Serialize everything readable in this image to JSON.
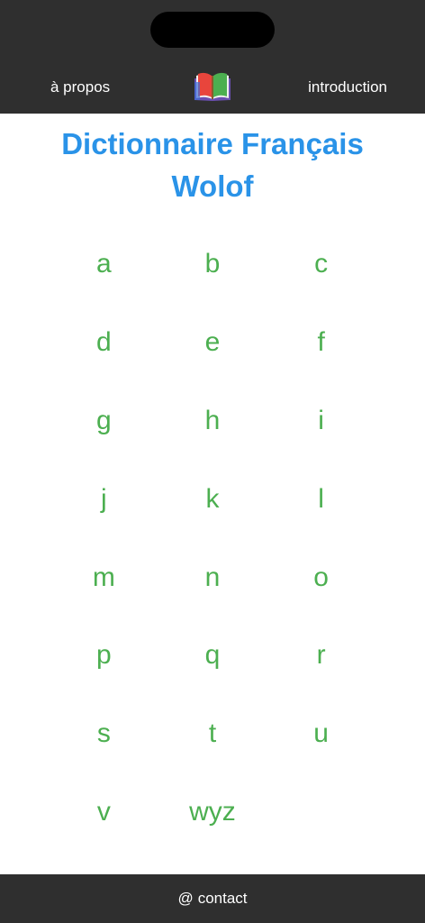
{
  "header": {
    "about_label": "à propos",
    "intro_label": "introduction",
    "logo_icon": "open-book-icon"
  },
  "title": {
    "line1": "Dictionnaire Français",
    "line2": "Wolof"
  },
  "letters": [
    "a",
    "b",
    "c",
    "d",
    "e",
    "f",
    "g",
    "h",
    "i",
    "j",
    "k",
    "l",
    "m",
    "n",
    "o",
    "p",
    "q",
    "r",
    "s",
    "t",
    "u",
    "v",
    "wyz"
  ],
  "footer": {
    "contact_symbol": "@",
    "contact_label": "contact"
  },
  "colors": {
    "bar_background": "#2f2f2f",
    "title": "#2a93e8",
    "letter": "#4caf50"
  }
}
